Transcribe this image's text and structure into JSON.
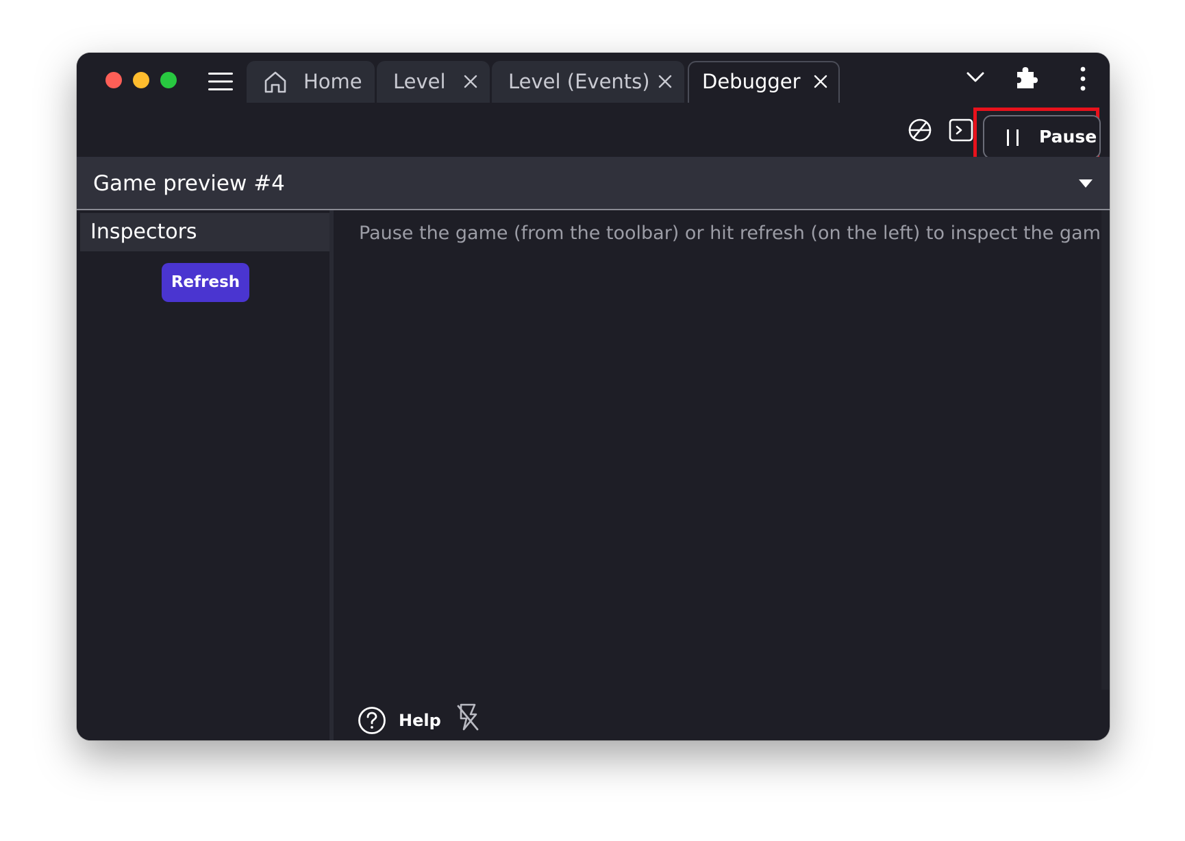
{
  "tabs": [
    {
      "label": "Home",
      "icon": "home-icon",
      "closable": false
    },
    {
      "label": "Level",
      "closable": true
    },
    {
      "label": "Level (Events)",
      "closable": true
    },
    {
      "label": "Debugger",
      "closable": true,
      "active": true
    }
  ],
  "toolbar": {
    "pause_label": "Pause",
    "icons": [
      "network-icon",
      "console-icon",
      "pause-icon"
    ],
    "highlight_color": "#e8121c"
  },
  "titlebar_icons": [
    "menu-icon",
    "chevron-down-icon",
    "puzzle-icon",
    "more-vertical-icon"
  ],
  "session": {
    "title": "Game preview #4"
  },
  "sidebar": {
    "header": "Inspectors",
    "refresh_label": "Refresh"
  },
  "content": {
    "message": "Pause the game (from the toolbar) or hit refresh (on the left) to inspect the game"
  },
  "footer": {
    "help_label": "Help",
    "icons": [
      "help-icon",
      "hot-reload-off-icon"
    ]
  },
  "colors": {
    "background": "#1e1e26",
    "accent": "#4a35d0",
    "tab_inactive": "#2b2d36"
  }
}
